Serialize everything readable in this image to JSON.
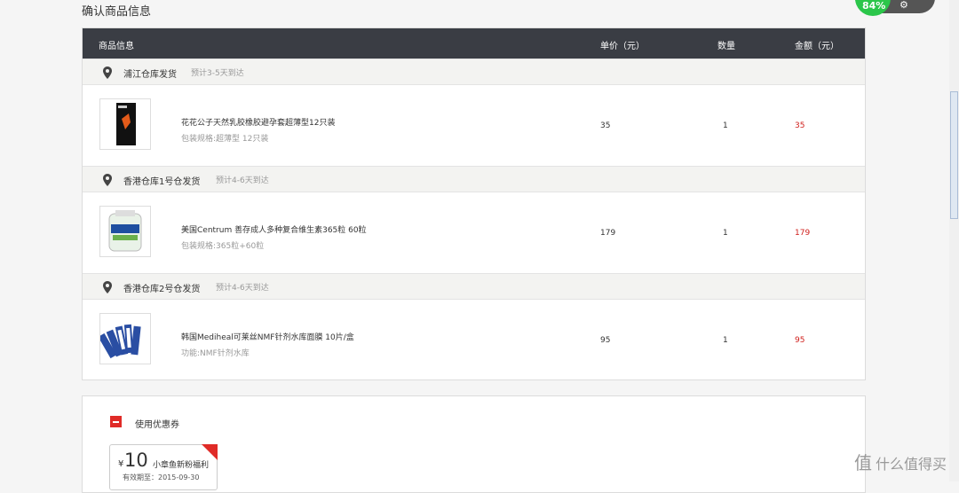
{
  "page": {
    "title": "确认商品信息"
  },
  "table": {
    "headers": {
      "info": "商品信息",
      "price": "单价（元）",
      "qty": "数量",
      "amount": "金额（元）"
    }
  },
  "warehouses": [
    {
      "name": "浦江仓库发货",
      "eta": "预计3-5天到达",
      "item": {
        "name": "花花公子天然乳胶橡胶避孕套超薄型12只装",
        "spec": "包装规格:超薄型 12只装",
        "price": "35",
        "qty": "1",
        "amount": "35"
      }
    },
    {
      "name": "香港仓库1号仓发货",
      "eta": "预计4-6天到达",
      "item": {
        "name": "美国Centrum 善存成人多种复合维生素365粒 60粒",
        "spec": "包装规格:365粒+60粒",
        "price": "179",
        "qty": "1",
        "amount": "179"
      }
    },
    {
      "name": "香港仓库2号仓发货",
      "eta": "预计4-6天到达",
      "item": {
        "name": "韩国Mediheal可莱丝NMF针剂水库面膜 10片/盒",
        "spec": "功能:NMF针剂水库",
        "price": "95",
        "qty": "1",
        "amount": "95"
      }
    }
  ],
  "coupon": {
    "label": "使用优惠券",
    "currency": "¥",
    "value": "10",
    "name": "小章鱼新粉福利",
    "expire": "有效期至：2015-09-30"
  },
  "float_widget": {
    "badge": "84%",
    "icon": "gear-icon"
  },
  "watermark": {
    "logo": "值",
    "text": "什么值得买"
  },
  "colors": {
    "header_bg": "#3a3d44",
    "accent_red": "#d0201d",
    "check_red": "#e02b27"
  }
}
